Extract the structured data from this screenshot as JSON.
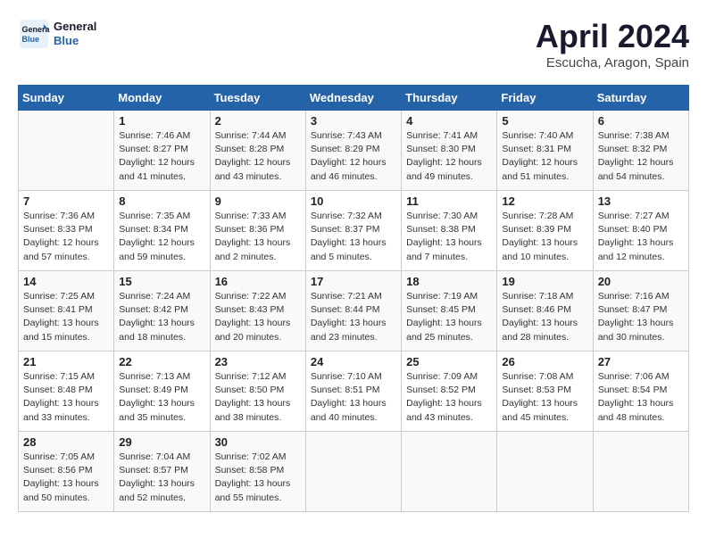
{
  "header": {
    "logo_line1": "General",
    "logo_line2": "Blue",
    "month": "April 2024",
    "location": "Escucha, Aragon, Spain"
  },
  "weekdays": [
    "Sunday",
    "Monday",
    "Tuesday",
    "Wednesday",
    "Thursday",
    "Friday",
    "Saturday"
  ],
  "weeks": [
    [
      {
        "num": "",
        "info": ""
      },
      {
        "num": "1",
        "info": "Sunrise: 7:46 AM\nSunset: 8:27 PM\nDaylight: 12 hours\nand 41 minutes."
      },
      {
        "num": "2",
        "info": "Sunrise: 7:44 AM\nSunset: 8:28 PM\nDaylight: 12 hours\nand 43 minutes."
      },
      {
        "num": "3",
        "info": "Sunrise: 7:43 AM\nSunset: 8:29 PM\nDaylight: 12 hours\nand 46 minutes."
      },
      {
        "num": "4",
        "info": "Sunrise: 7:41 AM\nSunset: 8:30 PM\nDaylight: 12 hours\nand 49 minutes."
      },
      {
        "num": "5",
        "info": "Sunrise: 7:40 AM\nSunset: 8:31 PM\nDaylight: 12 hours\nand 51 minutes."
      },
      {
        "num": "6",
        "info": "Sunrise: 7:38 AM\nSunset: 8:32 PM\nDaylight: 12 hours\nand 54 minutes."
      }
    ],
    [
      {
        "num": "7",
        "info": "Sunrise: 7:36 AM\nSunset: 8:33 PM\nDaylight: 12 hours\nand 57 minutes."
      },
      {
        "num": "8",
        "info": "Sunrise: 7:35 AM\nSunset: 8:34 PM\nDaylight: 12 hours\nand 59 minutes."
      },
      {
        "num": "9",
        "info": "Sunrise: 7:33 AM\nSunset: 8:36 PM\nDaylight: 13 hours\nand 2 minutes."
      },
      {
        "num": "10",
        "info": "Sunrise: 7:32 AM\nSunset: 8:37 PM\nDaylight: 13 hours\nand 5 minutes."
      },
      {
        "num": "11",
        "info": "Sunrise: 7:30 AM\nSunset: 8:38 PM\nDaylight: 13 hours\nand 7 minutes."
      },
      {
        "num": "12",
        "info": "Sunrise: 7:28 AM\nSunset: 8:39 PM\nDaylight: 13 hours\nand 10 minutes."
      },
      {
        "num": "13",
        "info": "Sunrise: 7:27 AM\nSunset: 8:40 PM\nDaylight: 13 hours\nand 12 minutes."
      }
    ],
    [
      {
        "num": "14",
        "info": "Sunrise: 7:25 AM\nSunset: 8:41 PM\nDaylight: 13 hours\nand 15 minutes."
      },
      {
        "num": "15",
        "info": "Sunrise: 7:24 AM\nSunset: 8:42 PM\nDaylight: 13 hours\nand 18 minutes."
      },
      {
        "num": "16",
        "info": "Sunrise: 7:22 AM\nSunset: 8:43 PM\nDaylight: 13 hours\nand 20 minutes."
      },
      {
        "num": "17",
        "info": "Sunrise: 7:21 AM\nSunset: 8:44 PM\nDaylight: 13 hours\nand 23 minutes."
      },
      {
        "num": "18",
        "info": "Sunrise: 7:19 AM\nSunset: 8:45 PM\nDaylight: 13 hours\nand 25 minutes."
      },
      {
        "num": "19",
        "info": "Sunrise: 7:18 AM\nSunset: 8:46 PM\nDaylight: 13 hours\nand 28 minutes."
      },
      {
        "num": "20",
        "info": "Sunrise: 7:16 AM\nSunset: 8:47 PM\nDaylight: 13 hours\nand 30 minutes."
      }
    ],
    [
      {
        "num": "21",
        "info": "Sunrise: 7:15 AM\nSunset: 8:48 PM\nDaylight: 13 hours\nand 33 minutes."
      },
      {
        "num": "22",
        "info": "Sunrise: 7:13 AM\nSunset: 8:49 PM\nDaylight: 13 hours\nand 35 minutes."
      },
      {
        "num": "23",
        "info": "Sunrise: 7:12 AM\nSunset: 8:50 PM\nDaylight: 13 hours\nand 38 minutes."
      },
      {
        "num": "24",
        "info": "Sunrise: 7:10 AM\nSunset: 8:51 PM\nDaylight: 13 hours\nand 40 minutes."
      },
      {
        "num": "25",
        "info": "Sunrise: 7:09 AM\nSunset: 8:52 PM\nDaylight: 13 hours\nand 43 minutes."
      },
      {
        "num": "26",
        "info": "Sunrise: 7:08 AM\nSunset: 8:53 PM\nDaylight: 13 hours\nand 45 minutes."
      },
      {
        "num": "27",
        "info": "Sunrise: 7:06 AM\nSunset: 8:54 PM\nDaylight: 13 hours\nand 48 minutes."
      }
    ],
    [
      {
        "num": "28",
        "info": "Sunrise: 7:05 AM\nSunset: 8:56 PM\nDaylight: 13 hours\nand 50 minutes."
      },
      {
        "num": "29",
        "info": "Sunrise: 7:04 AM\nSunset: 8:57 PM\nDaylight: 13 hours\nand 52 minutes."
      },
      {
        "num": "30",
        "info": "Sunrise: 7:02 AM\nSunset: 8:58 PM\nDaylight: 13 hours\nand 55 minutes."
      },
      {
        "num": "",
        "info": ""
      },
      {
        "num": "",
        "info": ""
      },
      {
        "num": "",
        "info": ""
      },
      {
        "num": "",
        "info": ""
      }
    ]
  ]
}
